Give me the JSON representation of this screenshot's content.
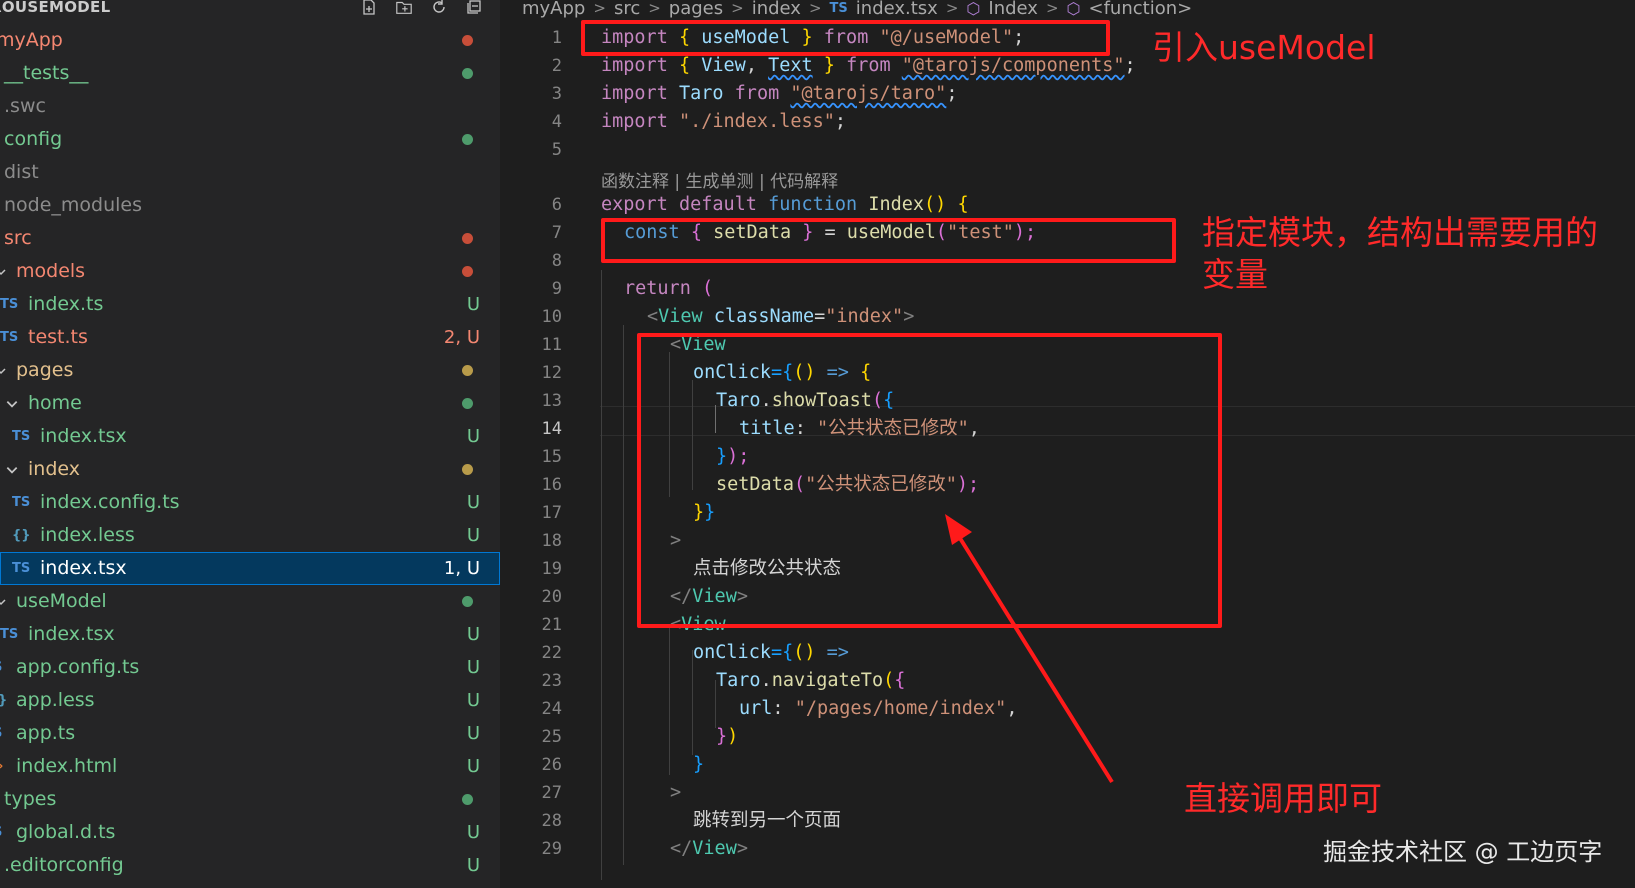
{
  "explorer": {
    "title": "ROUSEMODEL",
    "items": [
      {
        "label": "myApp",
        "status": ""
      },
      {
        "label": "__tests__",
        "status": ""
      },
      {
        "label": ".swc",
        "status": ""
      },
      {
        "label": "config",
        "status": ""
      },
      {
        "label": "dist",
        "status": ""
      },
      {
        "label": "node_modules",
        "status": ""
      },
      {
        "label": "src",
        "status": ""
      },
      {
        "label": "models",
        "status": ""
      },
      {
        "label": "index.ts",
        "status": "U"
      },
      {
        "label": "test.ts",
        "status": "2, U"
      },
      {
        "label": "pages",
        "status": ""
      },
      {
        "label": "home",
        "status": ""
      },
      {
        "label": "index.tsx",
        "status": "U"
      },
      {
        "label": "index",
        "status": ""
      },
      {
        "label": "index.config.ts",
        "status": "U"
      },
      {
        "label": "index.less",
        "status": "U"
      },
      {
        "label": "index.tsx",
        "status": "1, U"
      },
      {
        "label": "useModel",
        "status": ""
      },
      {
        "label": "index.tsx",
        "status": "U"
      },
      {
        "label": "app.config.ts",
        "status": "U"
      },
      {
        "label": "app.less",
        "status": "U"
      },
      {
        "label": "app.ts",
        "status": "U"
      },
      {
        "label": "index.html",
        "status": "U"
      },
      {
        "label": "types",
        "status": ""
      },
      {
        "label": "global.d.ts",
        "status": "U"
      },
      {
        "label": ".editorconfig",
        "status": "U"
      }
    ],
    "file_type_ts": "TS",
    "file_type_less": "{}",
    "colors": {
      "untracked": "#73c991",
      "modified": "#e2c08d",
      "error": "#f48771",
      "selected_bg": "#04395e"
    }
  },
  "breadcrumbs": [
    "myApp",
    "src",
    "pages",
    "index",
    "index.tsx",
    "Index",
    "<function>"
  ],
  "editor": {
    "line_numbers": [
      "1",
      "2",
      "3",
      "4",
      "5",
      "6",
      "7",
      "8",
      "9",
      "10",
      "11",
      "12",
      "13",
      "14",
      "15",
      "16",
      "17",
      "18",
      "19",
      "20",
      "21",
      "22",
      "23",
      "24",
      "25",
      "26",
      "27",
      "28",
      "29"
    ],
    "active_line": "14",
    "codelens": "函数注释 | 生成单测 | 代码解释",
    "code": {
      "l1": [
        "import",
        "{",
        "useModel",
        "}",
        "from",
        "\"@/useModel\"",
        ";"
      ],
      "l2": [
        "import",
        "{",
        "View",
        ",",
        "Text",
        "}",
        "from",
        "\"@tarojs/components\"",
        ";"
      ],
      "l3": [
        "import",
        "Taro",
        "from",
        "\"@tarojs/taro\"",
        ";"
      ],
      "l4": [
        "import",
        "\"./index.less\"",
        ";"
      ],
      "l6": [
        "export",
        "default",
        "function",
        "Index",
        "()",
        "{"
      ],
      "l7": [
        "const",
        "{",
        "setData",
        "}",
        "=",
        "useModel",
        "(",
        "\"test\"",
        ");"
      ],
      "l9": [
        "return",
        "("
      ],
      "l10": [
        "<",
        "View",
        "className",
        "=",
        "\"index\"",
        ">"
      ],
      "l11": [
        "<",
        "View"
      ],
      "l12": [
        "onClick",
        "={",
        "()",
        "=>",
        "{"
      ],
      "l13": [
        "Taro",
        ".",
        "showToast",
        "(",
        "{"
      ],
      "l14": [
        "title",
        ":",
        "\"公共状态已修改\"",
        ","
      ],
      "l15": [
        "}",
        ");"
      ],
      "l16": [
        "setData",
        "(",
        "\"公共状态已修改\"",
        ");"
      ],
      "l17": [
        "}",
        "}"
      ],
      "l18": [
        ">"
      ],
      "l19": [
        "点击修改公共状态"
      ],
      "l20": [
        "</",
        "View",
        ">"
      ],
      "l21": [
        "<",
        "View"
      ],
      "l22": [
        "onClick",
        "={",
        "()",
        "=>"
      ],
      "l23": [
        "Taro",
        ".",
        "navigateTo",
        "(",
        "{"
      ],
      "l24": [
        "url",
        ":",
        "\"/pages/home/index\"",
        ","
      ],
      "l25": [
        "}",
        ")"
      ],
      "l26": [
        "}"
      ],
      "l27": [
        ">"
      ],
      "l28": [
        "跳转到另一个页面"
      ],
      "l29": [
        "</",
        "View",
        ">"
      ]
    }
  },
  "annotations": {
    "import_note": "引入useModel",
    "destructure_note_1": "指定模块，结构出需要用的",
    "destructure_note_2": "变量",
    "call_note": "直接调用即可",
    "color": "#ff1a1a"
  },
  "watermark": "掘金技术社区 @ 工边页字"
}
